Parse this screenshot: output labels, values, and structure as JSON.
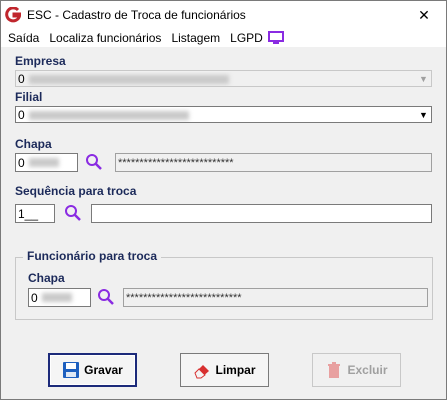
{
  "window": {
    "title": "ESC - Cadastro de Troca de funcionários",
    "close_glyph": "✕"
  },
  "menu": {
    "items": [
      {
        "label": "Saída"
      },
      {
        "label": "Localiza funcionários"
      },
      {
        "label": "Listagem"
      },
      {
        "label": "LGPD"
      }
    ]
  },
  "empresa": {
    "label": "Empresa",
    "value": "0"
  },
  "filial": {
    "label": "Filial",
    "value": "0"
  },
  "chapa": {
    "label": "Chapa",
    "value": "0",
    "name_mask": "***************************"
  },
  "sequencia": {
    "label": "Sequência para troca",
    "value": "1__",
    "description": ""
  },
  "funcionario_troca": {
    "group_title": "Funcionário para troca",
    "chapa_label": "Chapa",
    "value": "0",
    "name_mask": "***************************"
  },
  "buttons": {
    "gravar": "Gravar",
    "limpar": "Limpar",
    "excluir": "Excluir"
  },
  "colors": {
    "label": "#1c2a5a",
    "accent": "#8a2be2",
    "save_blue": "#1d5fbf",
    "eraser_red": "#d83030"
  }
}
